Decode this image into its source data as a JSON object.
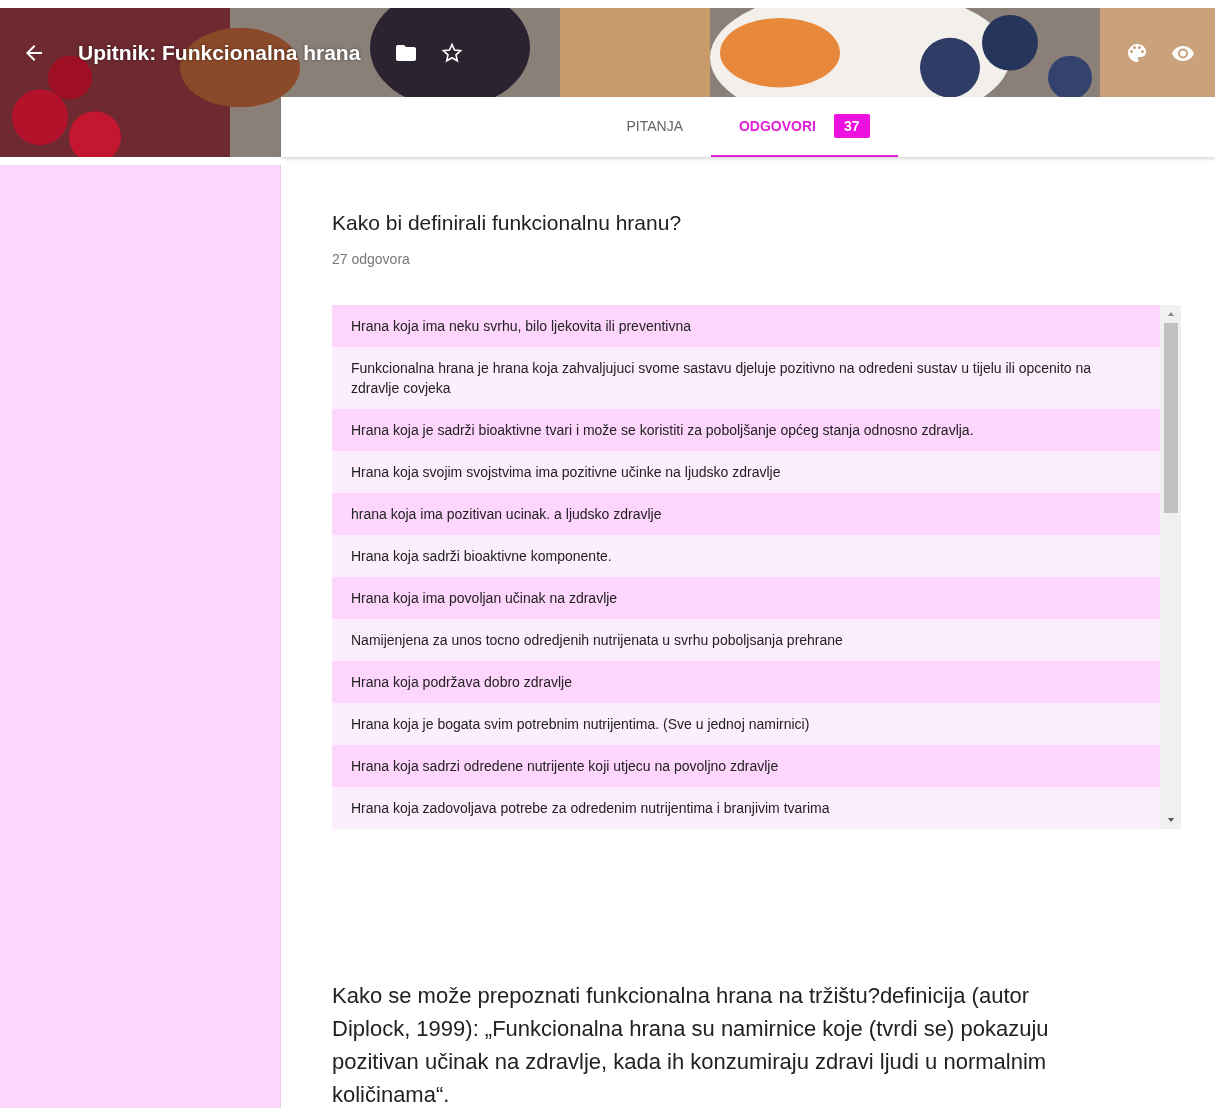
{
  "header": {
    "title": "Upitnik: Funkcionalna hrana"
  },
  "tabs": [
    {
      "label": "PITANJA",
      "selected": false
    },
    {
      "label": "ODGOVORI",
      "selected": true,
      "badge": "37"
    }
  ],
  "questions": [
    {
      "title": "Kako bi definirali funkcionalnu hranu?",
      "count": "27 odgovora",
      "responses": [
        "Hrana koja ima neku svrhu, bilo ljekovita ili preventivna",
        "Funkcionalna hrana je hrana koja zahvaljujuci svome sastavu djeluje pozitivno na odredeni sustav u tijelu ili opcenito na zdravlje covjeka",
        "Hrana koja je sadrži bioaktivne tvari i može se koristiti za poboljšanje općeg stanja odnosno zdravlja.",
        "Hrana koja svojim svojstvima ima pozitivne učinke na ljudsko zdravlje",
        "hrana koja ima pozitivan ucinak. a ljudsko zdravlje",
        "Hrana koja sadrži bioaktivne komponente.",
        "Hrana koja ima povoljan učinak na zdravlje",
        "Namijenjena za unos tocno odredjenih nutrijenata u svrhu poboljsanja prehrane",
        "Hrana koja podržava dobro zdravlje",
        "Hrana koja je bogata svim potrebnim nutrijentima. (Sve u jednoj namirnici)",
        "Hrana koja sadrzi odredene nutrijente koji utjecu na povoljno zdravlje",
        "Hrana koja zadovoljava potrebe za odredenim nutrijentima i branjivim tvarima"
      ]
    },
    {
      "title": "Kako se može prepoznati funkcionalna hrana na tržištu?definicija (autor Diplock, 1999): „Funkcionalna hrana su namirnice koje (tvrdi se) pokazuju pozitivan učinak na zdravlje, kada ih konzumiraju zdravi ljudi u normalnim količinama“."
    }
  ]
}
